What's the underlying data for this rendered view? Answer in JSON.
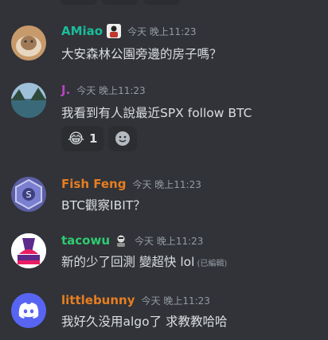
{
  "messages": [
    {
      "author": "AMiao",
      "author_color": "#1abc9c",
      "timestamp": "今天 晚上11:23",
      "text": "大安森林公園旁邊的房子嗎？"
    },
    {
      "author": "J.",
      "author_color": "#b845c1",
      "timestamp": "今天 晚上11:23",
      "text": "我看到有人說最近SPX follow BTC",
      "reaction_emoji": "😂",
      "reaction_count": "1"
    },
    {
      "author": "Fish Feng",
      "author_color": "#e67e22",
      "timestamp": "今天 晚上11:23",
      "text": "BTC觀察IBIT？"
    },
    {
      "author": "tacowu",
      "author_color": "#2ecc71",
      "timestamp": "今天 晚上11:23",
      "text": "新的少了回測 變超快 lol",
      "edited": "(已編輯)"
    },
    {
      "author": "littlebunny",
      "author_color": "#e67e22",
      "timestamp": "今天 晚上11:23",
      "text": "我好久没用algo了 求教教哈哈"
    }
  ],
  "icons": {
    "add_reaction": "smile-add-icon",
    "discord_avatar": "discord-logo-icon"
  }
}
